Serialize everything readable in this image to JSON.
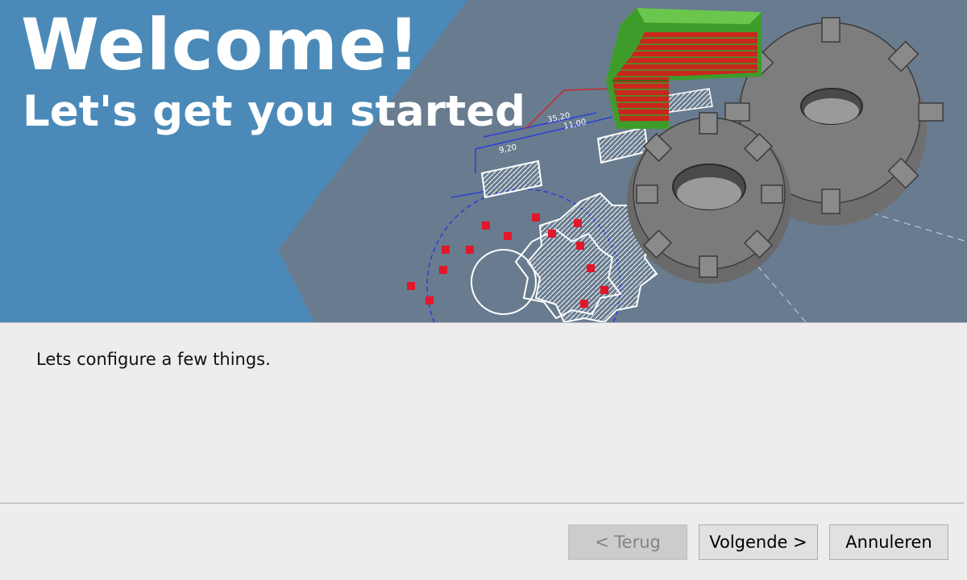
{
  "banner": {
    "title": "Welcome!",
    "subtitle": "Let's get you started",
    "colors": {
      "panel_blue": "#4b8ab8",
      "background_slate": "#687b8f"
    },
    "illustration_icon": "gear-cad-illustration-icon"
  },
  "body": {
    "message": "Lets configure a few things."
  },
  "buttons": {
    "back_label": "< Terug",
    "next_label": "Volgende >",
    "cancel_label": "Annuleren"
  }
}
